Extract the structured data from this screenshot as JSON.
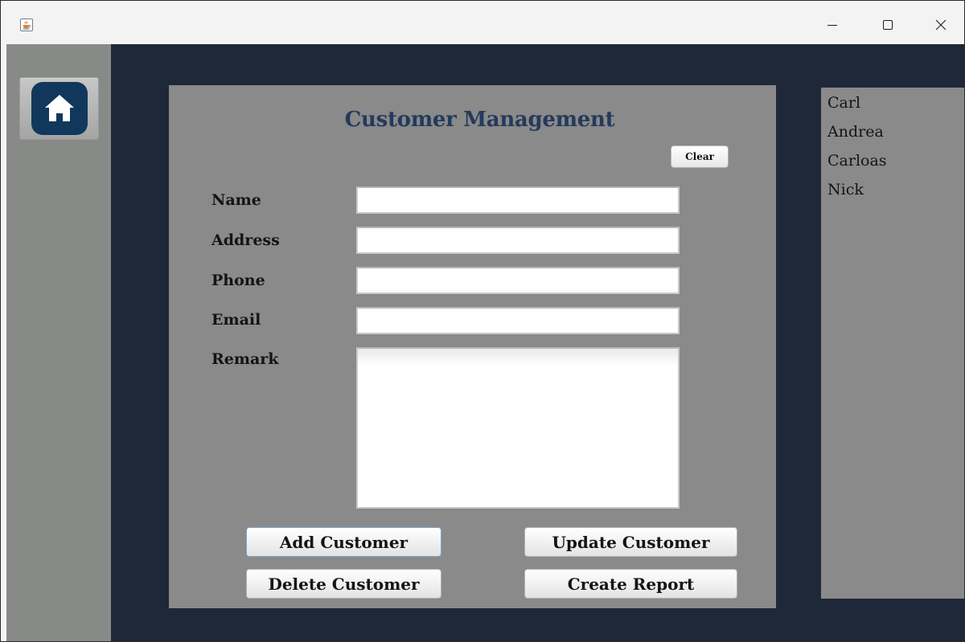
{
  "window": {
    "app_icon": "java-cup-icon",
    "controls": [
      "minimize-icon",
      "maximize-icon",
      "close-icon"
    ]
  },
  "sidebar": {
    "home_icon": "home-icon"
  },
  "form": {
    "title": "Customer Management",
    "clear_label": "Clear",
    "fields": [
      {
        "label": "Name",
        "value": ""
      },
      {
        "label": "Address",
        "value": ""
      },
      {
        "label": "Phone",
        "value": ""
      },
      {
        "label": "Email",
        "value": ""
      },
      {
        "label": "Remark",
        "value": ""
      }
    ],
    "buttons": {
      "add": "Add Customer",
      "update": "Update Customer",
      "delete": "Delete Customer",
      "report": "Create Report"
    }
  },
  "customers": [
    "Carl",
    "Andrea",
    "Carloas",
    "Nick"
  ],
  "colors": {
    "main_background": "#1f2838",
    "panel_gray": "#898a89",
    "title_blue": "#243a5c",
    "home_tile": "#11385c"
  }
}
